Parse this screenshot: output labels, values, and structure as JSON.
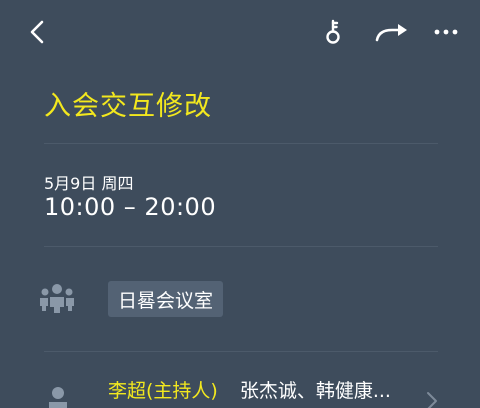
{
  "header": {
    "back_icon": "back-chevron-icon",
    "key_icon": "key-icon",
    "share_icon": "share-arrow-icon",
    "more_icon": "more-dots-icon"
  },
  "meeting": {
    "title": "入会交互修改",
    "date": "5月9日 周四",
    "time_range": "10:00 – 20:00",
    "room": "日晷会议室",
    "host": "李超(主持人)",
    "others": "张杰诚、韩健康..."
  },
  "colors": {
    "background": "#3e4c5c",
    "accent": "#f3e81e",
    "chip": "#536274"
  }
}
